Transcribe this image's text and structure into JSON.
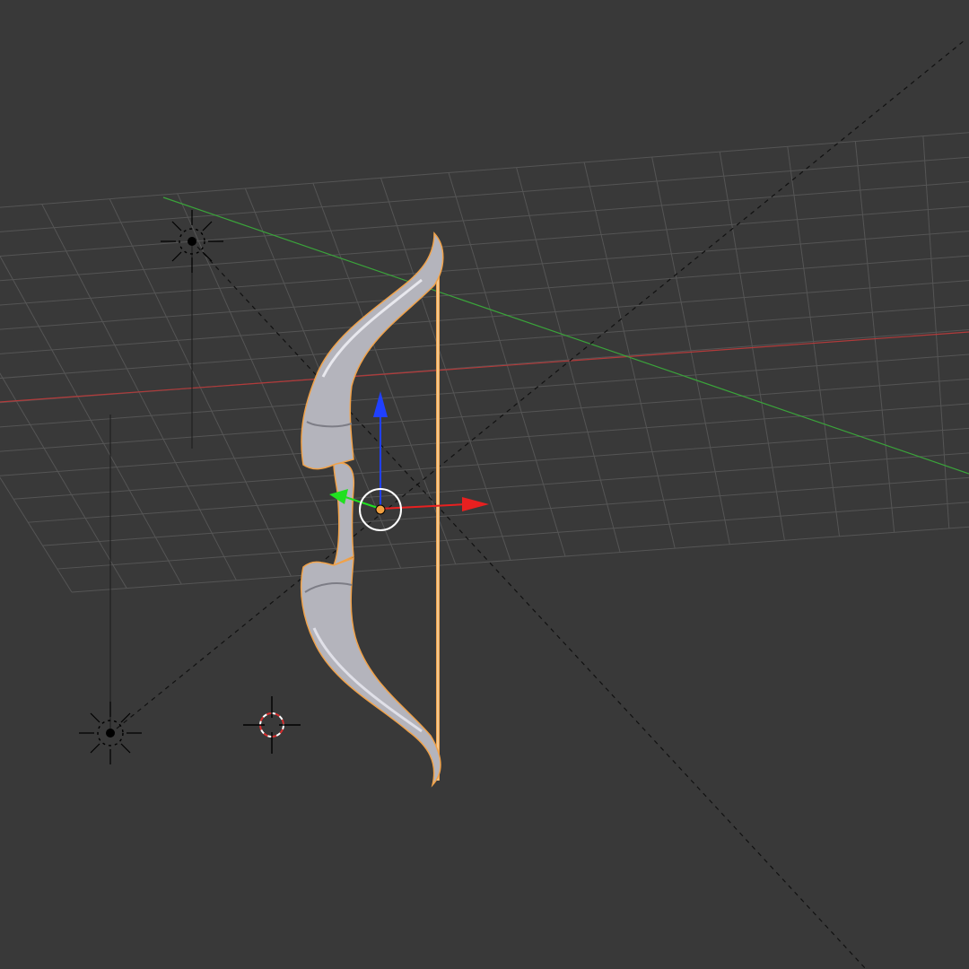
{
  "viewport": {
    "background": "#393939",
    "grid_color": "#555555",
    "x_axis_color": "#b23a3a",
    "y_axis_color": "#3aa33a"
  },
  "objects": {
    "bow": {
      "body_color": "#b4b4bc",
      "selection_outline": "#f0a24a"
    },
    "lamps": [
      {
        "name": "lamp-upper"
      },
      {
        "name": "lamp-lower"
      }
    ],
    "camera_lines": {
      "color": "#111111"
    }
  },
  "gizmo": {
    "mode": "translate",
    "x_color": "#e82020",
    "y_color": "#20e020",
    "z_color": "#2040ff",
    "pivot_color": "#f0a040"
  },
  "cursor_3d": {
    "ring_colors": [
      "#ffffff",
      "#d83030"
    ]
  }
}
